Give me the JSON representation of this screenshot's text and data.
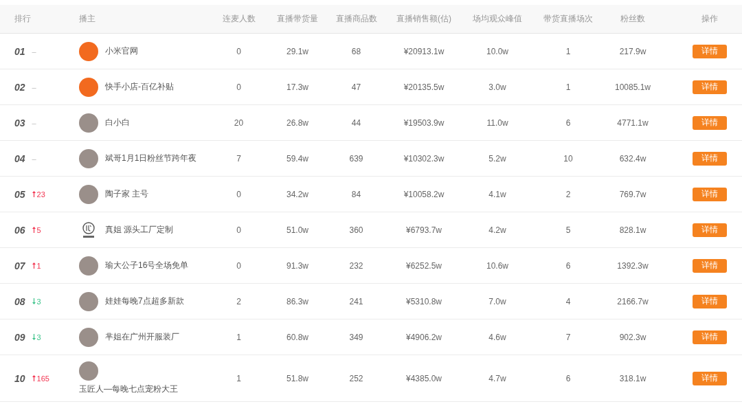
{
  "table": {
    "columns": [
      "排行",
      "播主",
      "连麦人数",
      "直播带货量",
      "直播商品数",
      "直播销售额(估)",
      "场均观众峰值",
      "带货直播场次",
      "粉丝数",
      "操作"
    ],
    "rows": [
      {
        "cells": [
          {
            "rank": "01",
            "change": {
              "kind": "none",
              "text": "–"
            }
          },
          {
            "avatar": {
              "kind": "logo"
            },
            "name": "小米官网"
          },
          "0",
          "29.1w",
          "68",
          "¥20913.1w",
          "10.0w",
          "1",
          "217.9w",
          "详情"
        ]
      },
      {
        "cells": [
          {
            "rank": "02",
            "change": {
              "kind": "none",
              "text": "–"
            }
          },
          {
            "avatar": {
              "kind": "logo"
            },
            "name": "快手小店-百亿补贴"
          },
          "0",
          "17.3w",
          "47",
          "¥20135.5w",
          "3.0w",
          "1",
          "10085.1w",
          "详情"
        ]
      },
      {
        "cells": [
          {
            "rank": "03",
            "change": {
              "kind": "none",
              "text": "–"
            }
          },
          {
            "avatar": {
              "kind": "photo"
            },
            "name": "白小白"
          },
          "20",
          "26.8w",
          "44",
          "¥19503.9w",
          "11.0w",
          "6",
          "4771.1w",
          "详情"
        ]
      },
      {
        "cells": [
          {
            "rank": "04",
            "change": {
              "kind": "none",
              "text": "–"
            }
          },
          {
            "avatar": {
              "kind": "photo"
            },
            "name": "斌哥1月1日粉丝节跨年夜"
          },
          "7",
          "59.4w",
          "639",
          "¥10302.3w",
          "5.2w",
          "10",
          "632.4w",
          "详情"
        ]
      },
      {
        "cells": [
          {
            "rank": "05",
            "change": {
              "kind": "up",
              "text": "23"
            }
          },
          {
            "avatar": {
              "kind": "photo"
            },
            "name": "陶子家 主号"
          },
          "0",
          "34.2w",
          "84",
          "¥10058.2w",
          "4.1w",
          "2",
          "769.7w",
          "详情"
        ]
      },
      {
        "cells": [
          {
            "rank": "06",
            "change": {
              "kind": "up",
              "text": "5"
            }
          },
          {
            "avatar": {
              "kind": "emblem"
            },
            "name": "真姐 源头工厂定制"
          },
          "0",
          "51.0w",
          "360",
          "¥6793.7w",
          "4.2w",
          "5",
          "828.1w",
          "详情"
        ]
      },
      {
        "cells": [
          {
            "rank": "07",
            "change": {
              "kind": "up",
              "text": "1"
            }
          },
          {
            "avatar": {
              "kind": "photo"
            },
            "name": "瑜大公子16号全场免单"
          },
          "0",
          "91.3w",
          "232",
          "¥6252.5w",
          "10.6w",
          "6",
          "1392.3w",
          "详情"
        ]
      },
      {
        "cells": [
          {
            "rank": "08",
            "change": {
              "kind": "down",
              "text": "3"
            }
          },
          {
            "avatar": {
              "kind": "photo"
            },
            "name": "娃娃每晚7点超多新款"
          },
          "2",
          "86.3w",
          "241",
          "¥5310.8w",
          "7.0w",
          "4",
          "2166.7w",
          "详情"
        ]
      },
      {
        "cells": [
          {
            "rank": "09",
            "change": {
              "kind": "down",
              "text": "3"
            }
          },
          {
            "avatar": {
              "kind": "photo"
            },
            "name": "芈姐在广州开服装厂"
          },
          "1",
          "60.8w",
          "349",
          "¥4906.2w",
          "4.6w",
          "7",
          "902.3w",
          "详情"
        ]
      },
      {
        "cells": [
          {
            "rank": "10",
            "change": {
              "kind": "up",
              "text": "165"
            }
          },
          {
            "avatar": {
              "kind": "photo"
            },
            "name": "玉匠人—每晚七点宠粉大王"
          },
          "1",
          "51.8w",
          "252",
          "¥4385.0w",
          "4.7w",
          "6",
          "318.1w",
          "详情"
        ]
      }
    ]
  }
}
